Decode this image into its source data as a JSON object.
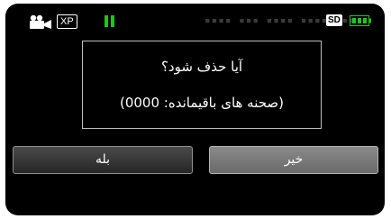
{
  "status_bar": {
    "camera_icon": "video-camera-icon",
    "quality": "XP",
    "state_icon": "pause-icon",
    "timecode_placeholder": "▪▪▪▪ ▪▪▪ ▪▪▪▪ ▪▪▪▪ ▪▪▪",
    "media": "SD",
    "battery_icon": "battery-icon",
    "colors": {
      "pause": "#22c322",
      "battery": "#22c322"
    }
  },
  "dialog": {
    "question": "آیا حذف شود؟",
    "remaining": "(صحنه های باقیمانده: 0000)"
  },
  "buttons": {
    "yes_label": "بله",
    "no_label": "خیر"
  }
}
